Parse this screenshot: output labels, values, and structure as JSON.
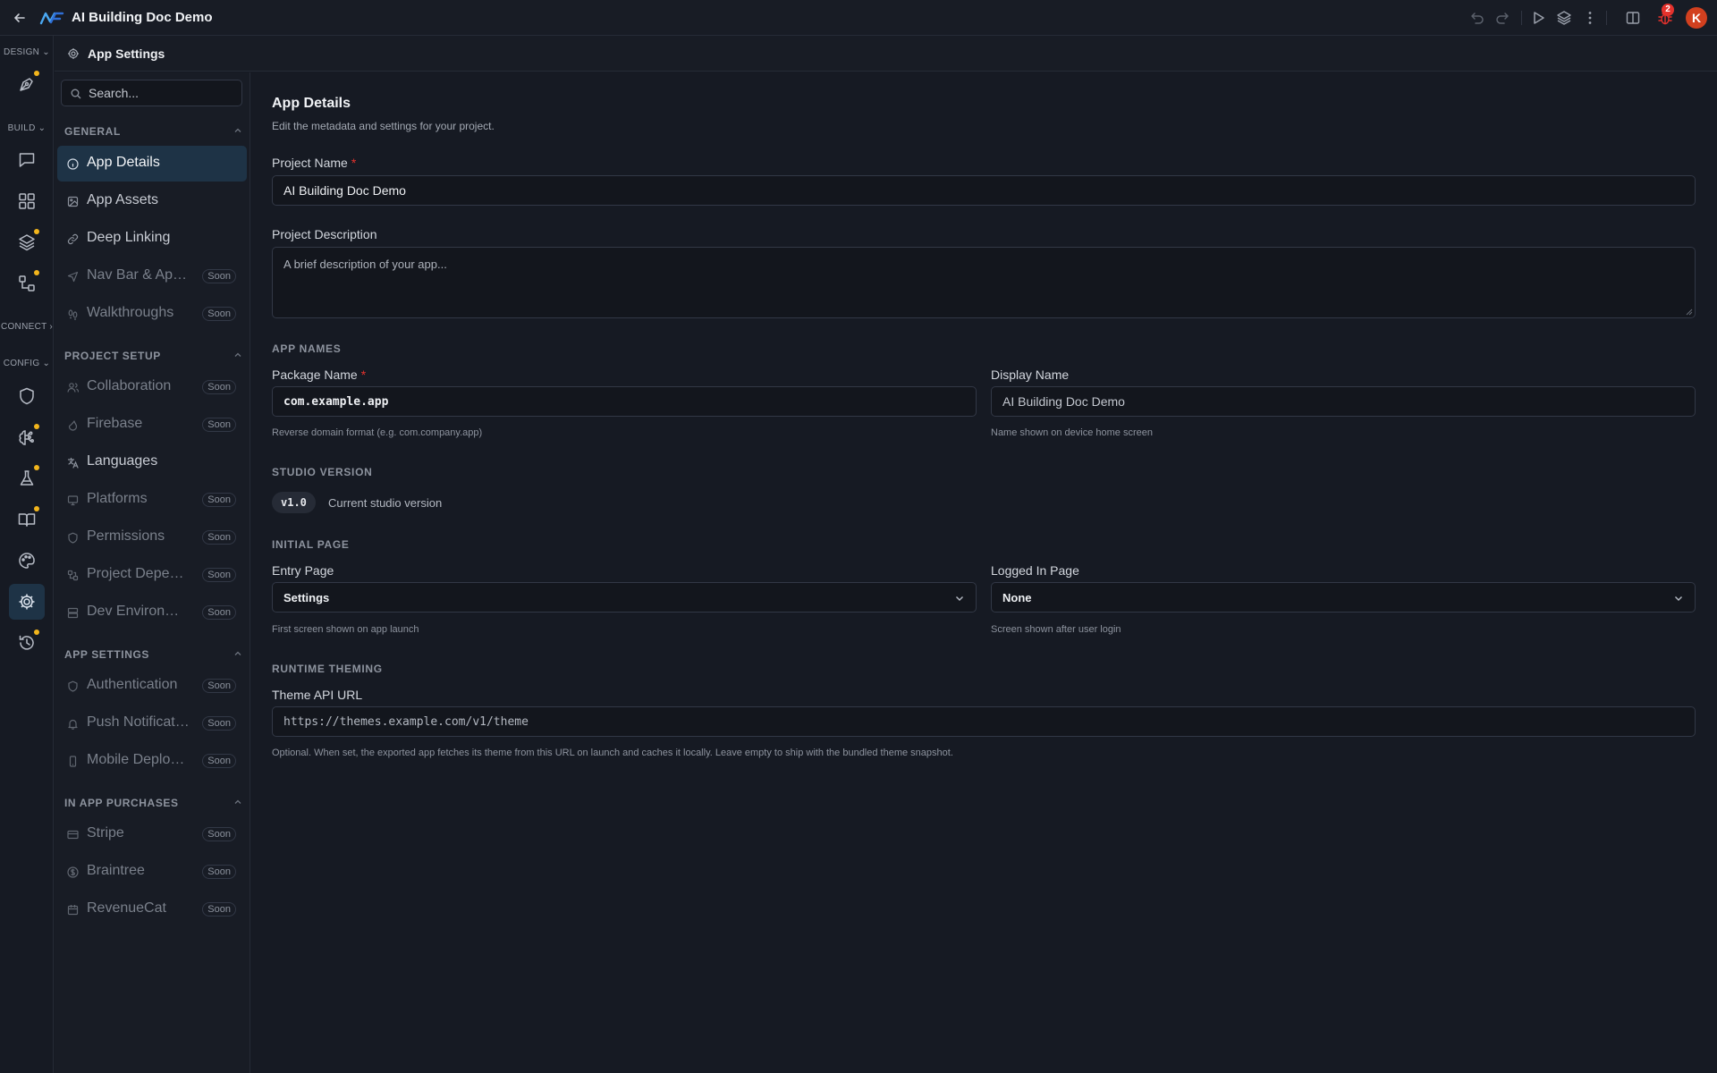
{
  "app": {
    "title": "AI Building Doc Demo",
    "notification_count": "2",
    "avatar_initial": "K"
  },
  "colors": {
    "background": "#161a23",
    "panel": "#181c25",
    "active_item": "#1e3346",
    "required": "#e5322d",
    "badge_dot": "#f2b51c",
    "avatar": "#d2401f"
  },
  "rail": {
    "sections": {
      "design": "DESIGN",
      "build": "BUILD",
      "connect": "CONNECT",
      "config": "CONFIG"
    },
    "items": [
      {
        "icon": "pen-tool-icon",
        "dot": true
      },
      {
        "icon": "chat-icon",
        "dot": false
      },
      {
        "icon": "grid-icon",
        "dot": false
      },
      {
        "icon": "layers-icon",
        "dot": true
      },
      {
        "icon": "components-icon",
        "dot": true
      },
      {
        "icon": "shield-icon",
        "dot": false
      },
      {
        "icon": "brain-icon",
        "dot": true
      },
      {
        "icon": "flask-icon",
        "dot": true
      },
      {
        "icon": "book-icon",
        "dot": true
      },
      {
        "icon": "palette-icon",
        "dot": false
      },
      {
        "icon": "gear-icon",
        "dot": false,
        "active": true
      },
      {
        "icon": "history-icon",
        "dot": true
      }
    ]
  },
  "header": {
    "title": "App Settings"
  },
  "sidebar": {
    "search_placeholder": "Search...",
    "soon_label": "Soon",
    "groups": {
      "general": "GENERAL",
      "project_setup": "PROJECT SETUP",
      "app_settings": "APP SETTINGS",
      "in_app_purchases": "IN APP PURCHASES"
    },
    "items": {
      "app_details": "App Details",
      "app_assets": "App Assets",
      "deep_linking": "Deep Linking",
      "nav_bar": "Nav Bar & App Bar",
      "walkthroughs": "Walkthroughs",
      "collaboration": "Collaboration",
      "firebase": "Firebase",
      "languages": "Languages",
      "platforms": "Platforms",
      "permissions": "Permissions",
      "project_dependencies": "Project Dependencies",
      "dev_environments": "Dev Environments",
      "authentication": "Authentication",
      "push_notifications": "Push Notifications",
      "mobile_deployment": "Mobile Deployment",
      "stripe": "Stripe",
      "braintree": "Braintree",
      "revenuecat": "RevenueCat"
    }
  },
  "main": {
    "title": "App Details",
    "subtitle": "Edit the metadata and settings for your project.",
    "project_name": {
      "label": "Project Name",
      "required": "*",
      "value": "AI Building Doc Demo"
    },
    "project_description": {
      "label": "Project Description",
      "placeholder": "A brief description of your app..."
    },
    "app_names": {
      "section": "APP NAMES",
      "package_label": "Package Name",
      "package_required": "*",
      "package_value": "com.example.app",
      "package_hint": "Reverse domain format (e.g. com.company.app)",
      "display_label": "Display Name",
      "display_value": "AI Building Doc Demo",
      "display_hint": "Name shown on device home screen"
    },
    "studio_version": {
      "section": "STUDIO VERSION",
      "badge": "v1.0",
      "text": "Current studio version"
    },
    "initial_page": {
      "section": "INITIAL PAGE",
      "entry_label": "Entry Page",
      "entry_value": "Settings",
      "entry_hint": "First screen shown on app launch",
      "logged_label": "Logged In Page",
      "logged_value": "None",
      "logged_hint": "Screen shown after user login"
    },
    "runtime_theming": {
      "section": "RUNTIME THEMING",
      "label": "Theme API URL",
      "value": "https://themes.example.com/v1/theme",
      "hint": "Optional. When set, the exported app fetches its theme from this URL on launch and caches it locally. Leave empty to ship with the bundled theme snapshot."
    }
  }
}
